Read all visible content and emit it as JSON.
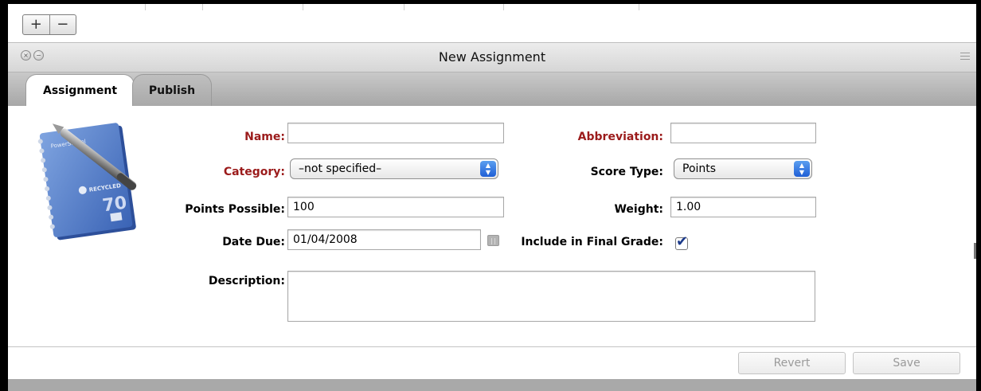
{
  "toolbar": {
    "add_label": "+",
    "remove_label": "−"
  },
  "window": {
    "title": "New Assignment",
    "close_glyph": "×",
    "minimize_glyph": "−"
  },
  "tabs": [
    {
      "label": "Assignment",
      "active": true
    },
    {
      "label": "Publish",
      "active": false
    }
  ],
  "notebook": {
    "brand": "PowerSchool",
    "tag": "RECYCLED",
    "number": "70"
  },
  "form": {
    "name": {
      "label": "Name:",
      "value": ""
    },
    "abbreviation": {
      "label": "Abbreviation:",
      "value": ""
    },
    "category": {
      "label": "Category:",
      "value": "–not specified–"
    },
    "score_type": {
      "label": "Score Type:",
      "value": "Points"
    },
    "points_possible": {
      "label": "Points Possible:",
      "value": "100"
    },
    "weight": {
      "label": "Weight:",
      "value": "1.00"
    },
    "date_due": {
      "label": "Date Due:",
      "value": "01/04/2008"
    },
    "include_final": {
      "label": "Include in Final Grade:",
      "checked": true,
      "glyph": "✔"
    },
    "description": {
      "label": "Description:",
      "value": ""
    }
  },
  "footer": {
    "revert_label": "Revert",
    "save_label": "Save"
  },
  "colors": {
    "required_label": "#9b1b1b",
    "select_arrow": "#1f5fd6",
    "checkbox_mark": "#1c3a8a"
  },
  "icons": {
    "add": "plus-icon",
    "remove": "minus-icon",
    "close": "close-icon",
    "minimize": "minimize-icon",
    "menu": "menu-icon",
    "calendar": "calendar-icon",
    "select_arrows": "up-down-arrows-icon",
    "notebook": "notebook-icon"
  }
}
